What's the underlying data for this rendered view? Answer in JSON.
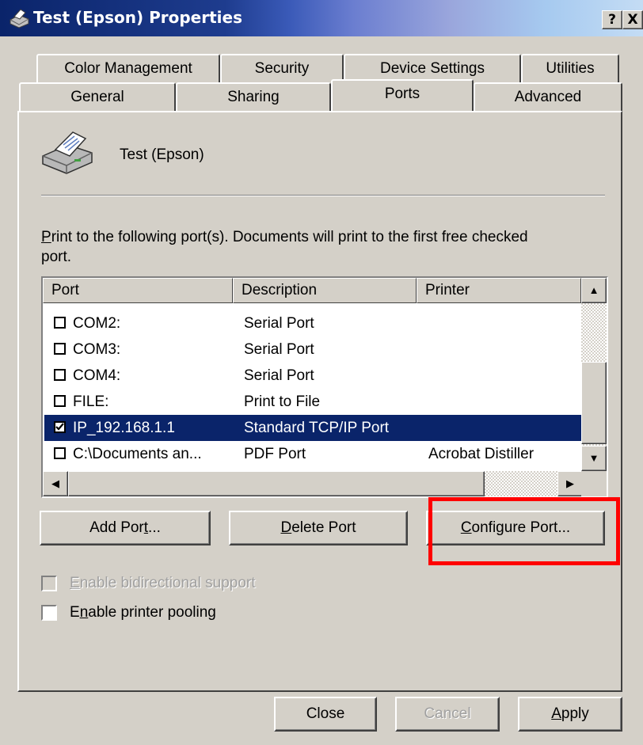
{
  "window": {
    "title": "Test (Epson) Properties",
    "help_button": "?",
    "close_button": "X"
  },
  "tabs": {
    "back_row": [
      "Color Management",
      "Security",
      "Device Settings",
      "Utilities"
    ],
    "front_row": [
      "General",
      "Sharing",
      "Ports",
      "Advanced"
    ],
    "active": "Ports"
  },
  "printer": {
    "name": "Test (Epson)"
  },
  "instructions": {
    "first_letter": "P",
    "rest": "rint to the following port(s). Documents will print to the first free checked port."
  },
  "port_list": {
    "columns": [
      "Port",
      "Description",
      "Printer"
    ],
    "rows": [
      {
        "checked": false,
        "port": "COM2:",
        "description": "Serial Port",
        "printer": ""
      },
      {
        "checked": false,
        "port": "COM3:",
        "description": "Serial Port",
        "printer": ""
      },
      {
        "checked": false,
        "port": "COM4:",
        "description": "Serial Port",
        "printer": ""
      },
      {
        "checked": false,
        "port": "FILE:",
        "description": "Print to File",
        "printer": ""
      },
      {
        "checked": true,
        "port": "IP_192.168.1.1",
        "description": "Standard TCP/IP Port",
        "printer": "",
        "selected": true
      },
      {
        "checked": false,
        "port": "C:\\Documents an...",
        "description": "PDF Port",
        "printer": "Acrobat Distiller"
      }
    ]
  },
  "port_buttons": {
    "add": {
      "before": "Add Por",
      "accel": "t",
      "after": "..."
    },
    "delete": {
      "before": "",
      "accel": "D",
      "after": "elete Port"
    },
    "configure": {
      "before": "",
      "accel": "C",
      "after": "onfigure Port..."
    }
  },
  "options": {
    "bidirectional": {
      "before": "",
      "accel": "E",
      "after": "nable bidirectional support",
      "checked": false,
      "enabled": false
    },
    "pooling": {
      "before": "E",
      "accel": "n",
      "after": "able printer pooling",
      "checked": false,
      "enabled": true
    }
  },
  "dialog_buttons": {
    "close": "Close",
    "cancel": "Cancel",
    "apply": {
      "accel": "A",
      "after": "pply"
    }
  },
  "colors": {
    "highlight_box": "#ff0000",
    "selection": "#0a246a",
    "face": "#d4d0c8"
  }
}
